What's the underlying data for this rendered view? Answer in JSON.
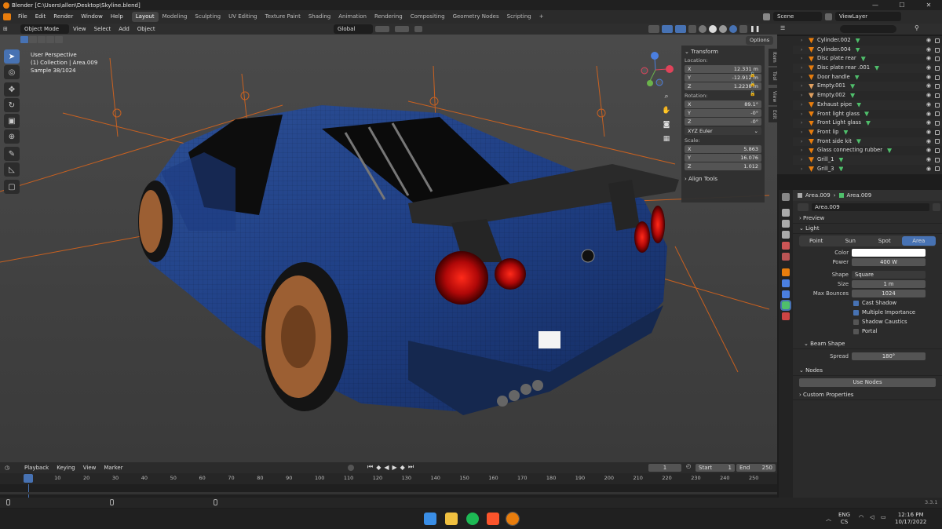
{
  "title_bar": {
    "title": "Blender [C:\\Users\\allen\\Desktop\\Skyline.blend]",
    "minimize": "—",
    "maximize": "☐",
    "close": "✕"
  },
  "top_bar": {
    "menus": [
      "File",
      "Edit",
      "Render",
      "Window",
      "Help"
    ],
    "workspaces": [
      "Layout",
      "Modeling",
      "Sculpting",
      "UV Editing",
      "Texture Paint",
      "Shading",
      "Animation",
      "Rendering",
      "Compositing",
      "Geometry Nodes",
      "Scripting"
    ],
    "add_workspace": "+",
    "scene": "Scene",
    "view_layer": "ViewLayer"
  },
  "viewport_header": {
    "mode": "Object Mode",
    "menus": [
      "View",
      "Select",
      "Add",
      "Object"
    ],
    "orientation": "Global",
    "options": "Options"
  },
  "viewport_overlay": {
    "line1": "User Perspective",
    "line2": "(1) Collection | Area.009",
    "line3": "Sample 38/1024"
  },
  "n_panel": {
    "transform_header": "Transform",
    "location_label": "Location:",
    "location": [
      {
        "axis": "X",
        "value": "12.331 m"
      },
      {
        "axis": "Y",
        "value": "-12.912 m"
      },
      {
        "axis": "Z",
        "value": "1.2238 m"
      }
    ],
    "rotation_label": "Rotation:",
    "rotation": [
      {
        "axis": "X",
        "value": "89.1°"
      },
      {
        "axis": "Y",
        "value": "-0°"
      },
      {
        "axis": "Z",
        "value": "-0°"
      }
    ],
    "rotation_mode": "XYZ Euler",
    "scale_label": "Scale:",
    "scale": [
      {
        "axis": "X",
        "value": "5.863"
      },
      {
        "axis": "Y",
        "value": "16.076"
      },
      {
        "axis": "Z",
        "value": "1.012"
      }
    ],
    "align_tools": "Align Tools",
    "side_tabs": [
      "Item",
      "Tool",
      "View",
      "Edit"
    ]
  },
  "outliner": {
    "items": [
      "Cylinder.002",
      "Cylinder.004",
      "Disc plate rear",
      "Disc plate rear .001",
      "Door handle",
      "Empty.001",
      "Empty.002",
      "Exhaust pipe",
      "Front light glass",
      "Front Light glass",
      "Front lip",
      "Front side kit",
      "Glass connecting rubber",
      "Grill_1",
      "Grill_3"
    ]
  },
  "properties": {
    "breadcrumb_obj": "Area.009",
    "breadcrumb_data": "Area.009",
    "datablock": "Area.009",
    "preview": "Preview",
    "light": "Light",
    "light_types": [
      "Point",
      "Sun",
      "Spot",
      "Area"
    ],
    "color_label": "Color",
    "power_label": "Power",
    "power": "400 W",
    "shape_label": "Shape",
    "shape": "Square",
    "size_label": "Size",
    "size": "1 m",
    "bounces_label": "Max Bounces",
    "bounces": "1024",
    "cast_shadow": "Cast Shadow",
    "multiple_importance": "Multiple Importance",
    "shadow_caustics": "Shadow Caustics",
    "portal": "Portal",
    "beam_shape": "Beam Shape",
    "spread_label": "Spread",
    "spread": "180°",
    "nodes": "Nodes",
    "use_nodes": "Use Nodes",
    "custom_properties": "Custom Properties"
  },
  "timeline": {
    "menus": [
      "Playback",
      "Keying",
      "View",
      "Marker"
    ],
    "current_frame": "1",
    "start_label": "Start",
    "start": "1",
    "end_label": "End",
    "end": "250",
    "ticks": [
      "1",
      "10",
      "20",
      "30",
      "40",
      "50",
      "60",
      "70",
      "80",
      "90",
      "100",
      "110",
      "120",
      "130",
      "140",
      "150",
      "160",
      "170",
      "180",
      "190",
      "200",
      "210",
      "220",
      "230",
      "240",
      "250"
    ]
  },
  "status": {
    "version": "3.3.1"
  },
  "taskbar": {
    "lang1": "ENG",
    "lang2": "CS",
    "time": "12:16 PM",
    "date": "10/17/2022"
  },
  "colors": {
    "accent": "#4772b3",
    "orange": "#e87d0d",
    "light_icon": "#4fbf6b",
    "empty_icon": "#e0a060"
  }
}
